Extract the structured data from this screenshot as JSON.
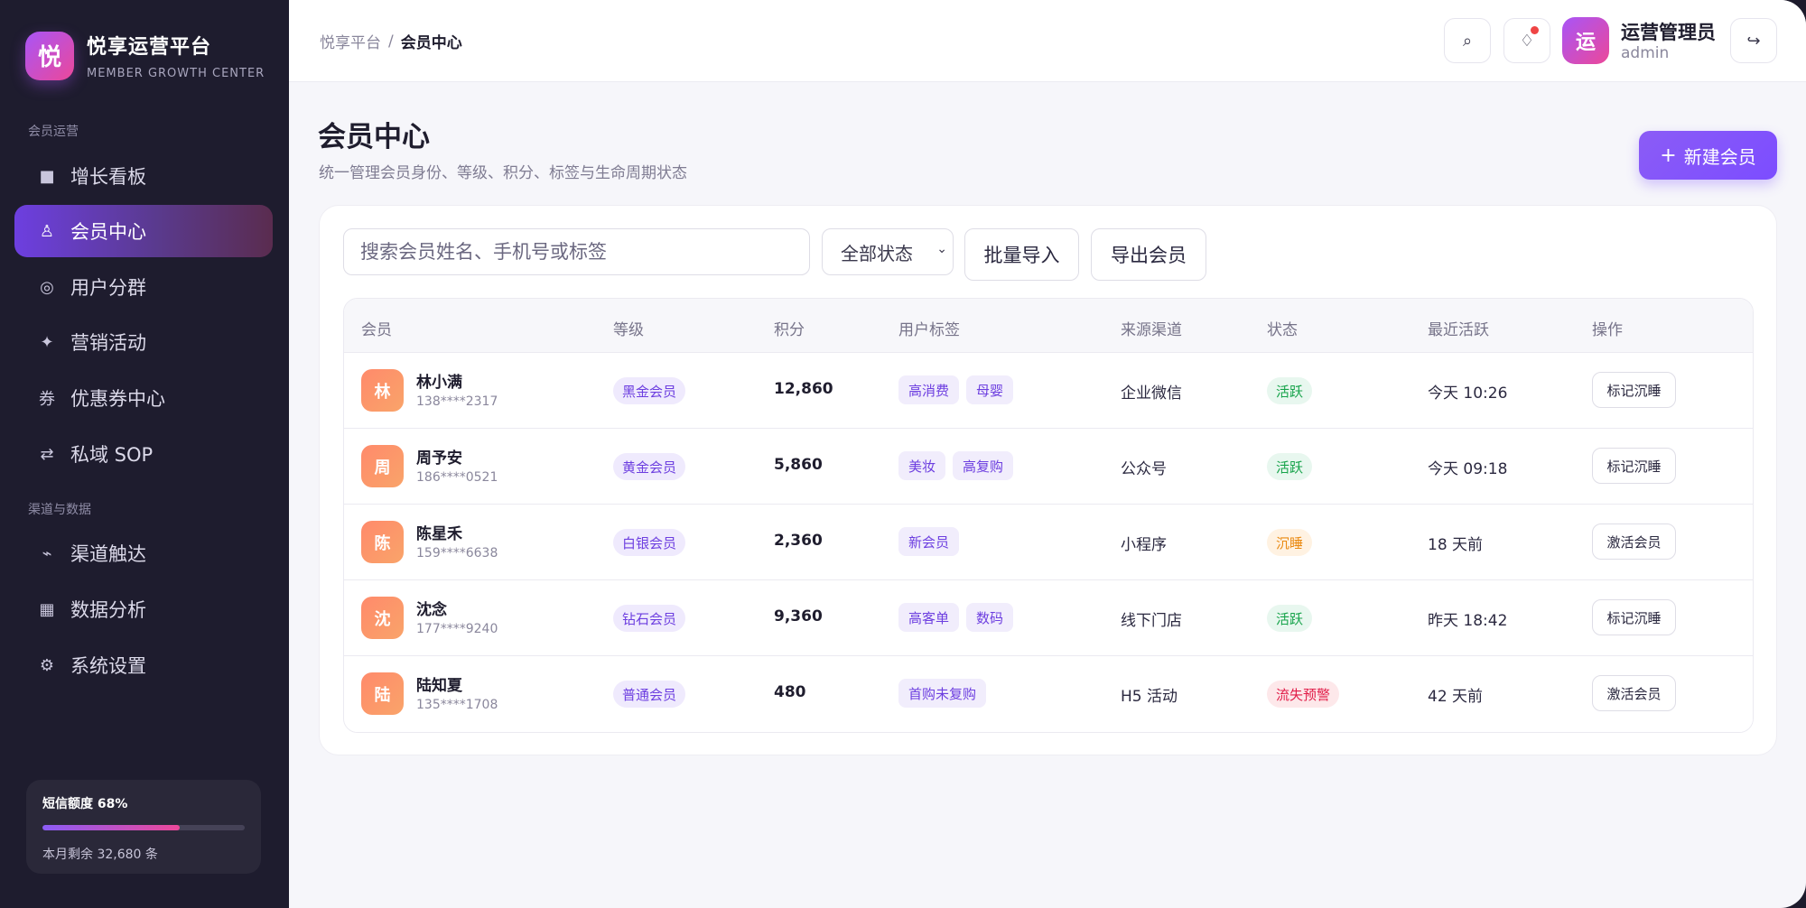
{
  "brand": {
    "logo_char": "悦",
    "name": "悦享运营平台",
    "subtitle": "MEMBER GROWTH CENTER"
  },
  "sidebar": {
    "groups": [
      "会员运营",
      "渠道与数据"
    ],
    "items": [
      {
        "label": "增长看板",
        "icon": "dashboard-icon",
        "glyph": "■"
      },
      {
        "label": "会员中心",
        "icon": "member-icon",
        "glyph": "♙"
      },
      {
        "label": "用户分群",
        "icon": "segment-icon",
        "glyph": "◎"
      },
      {
        "label": "营销活动",
        "icon": "sparkle-icon",
        "glyph": "✦"
      },
      {
        "label": "优惠券中心",
        "icon": "coupon-icon",
        "glyph": "券"
      },
      {
        "label": "私域 SOP",
        "icon": "sync-icon",
        "glyph": "⇄"
      },
      {
        "label": "渠道触达",
        "icon": "pulse-icon",
        "glyph": "⌁"
      },
      {
        "label": "数据分析",
        "icon": "chart-icon",
        "glyph": "▦"
      },
      {
        "label": "系统设置",
        "icon": "gear-icon",
        "glyph": "⚙"
      }
    ],
    "quota": {
      "title": "短信额度 68%",
      "percent": 68,
      "remaining": "本月剩余 32,680 条"
    }
  },
  "header": {
    "breadcrumb": {
      "root": "悦享平台",
      "sep": "/",
      "current": "会员中心"
    },
    "search_glyph": "⌕",
    "notify_glyph": "♢",
    "logout_glyph": "↪",
    "user": {
      "avatar_char": "运",
      "name": "运营管理员",
      "role": "admin"
    }
  },
  "page": {
    "title": "会员中心",
    "description": "统一管理会员身份、等级、积分、标签与生命周期状态",
    "new_button": "新建会员",
    "new_plus": "+"
  },
  "toolbar": {
    "search_placeholder": "搜索会员姓名、手机号或标签",
    "status_select": "全部状态",
    "chevron": "⌄",
    "import_button": "批量导入",
    "export_button": "导出会员"
  },
  "table": {
    "columns": [
      "会员",
      "等级",
      "积分",
      "用户标签",
      "来源渠道",
      "状态",
      "最近活跃",
      "操作"
    ],
    "rows": [
      {
        "avatar": "林",
        "name": "林小满",
        "phone": "138****2317",
        "level": "黑金会员",
        "points": "12,860",
        "tags": [
          "高消费",
          "母婴"
        ],
        "channel": "企业微信",
        "status": "活跃",
        "status_kind": "green",
        "recent": "今天 10:26",
        "action": "标记沉睡"
      },
      {
        "avatar": "周",
        "name": "周予安",
        "phone": "186****0521",
        "level": "黄金会员",
        "points": "5,860",
        "tags": [
          "美妆",
          "高复购"
        ],
        "channel": "公众号",
        "status": "活跃",
        "status_kind": "green",
        "recent": "今天 09:18",
        "action": "标记沉睡"
      },
      {
        "avatar": "陈",
        "name": "陈星禾",
        "phone": "159****6638",
        "level": "白银会员",
        "points": "2,360",
        "tags": [
          "新会员"
        ],
        "channel": "小程序",
        "status": "沉睡",
        "status_kind": "orange",
        "recent": "18 天前",
        "action": "激活会员"
      },
      {
        "avatar": "沈",
        "name": "沈念",
        "phone": "177****9240",
        "level": "钻石会员",
        "points": "9,360",
        "tags": [
          "高客单",
          "数码"
        ],
        "channel": "线下门店",
        "status": "活跃",
        "status_kind": "green",
        "recent": "昨天 18:42",
        "action": "标记沉睡"
      },
      {
        "avatar": "陆",
        "name": "陆知夏",
        "phone": "135****1708",
        "level": "普通会员",
        "points": "480",
        "tags": [
          "首购未复购"
        ],
        "channel": "H5 活动",
        "status": "流失预警",
        "status_kind": "red",
        "recent": "42 天前",
        "action": "激活会员"
      }
    ]
  }
}
